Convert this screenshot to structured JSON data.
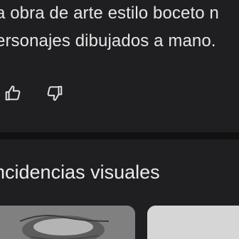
{
  "description": {
    "line1": "a obra de arte estilo boceto n",
    "line2": "ersonajes dibujados a mano."
  },
  "feedback": {
    "thumbs_up_icon": "thumbs-up-outline",
    "thumbs_down_icon": "thumbs-down-outline"
  },
  "visual_matches": {
    "title": "ncidencias visuales"
  },
  "colors": {
    "background": "#1f1f21",
    "divider": "#111112",
    "text": "#e6e6e6"
  }
}
